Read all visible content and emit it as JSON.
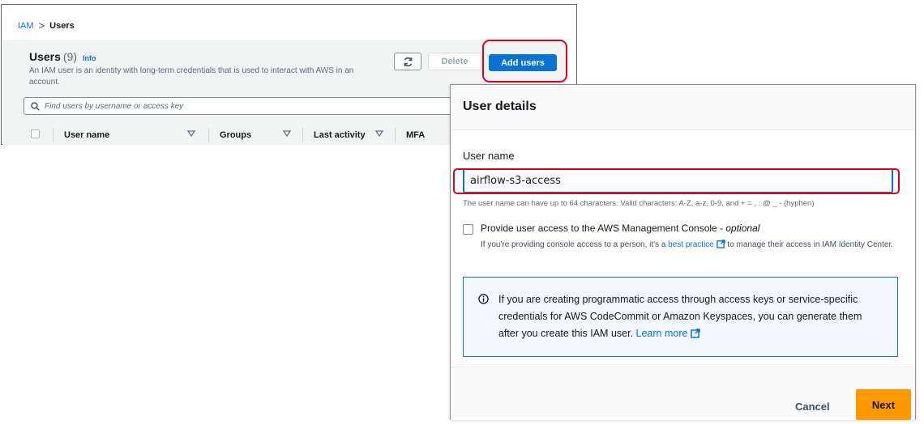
{
  "breadcrumb": {
    "root": "IAM",
    "separator": ">",
    "current": "Users"
  },
  "users": {
    "title": "Users",
    "count": "(9)",
    "info": "Info",
    "description": "An IAM user is an identity with long-term credentials that is used to interact with AWS in an account.",
    "delete_label": "Delete",
    "add_label": "Add users",
    "search_placeholder": "Find users by username or access key",
    "columns": [
      "User name",
      "Groups",
      "Last activity",
      "MFA"
    ]
  },
  "modal": {
    "title": "User details",
    "username_label": "User name",
    "username_value": "airflow-s3-access",
    "username_hint": "The user name can have up to 64 characters. Valid characters: A-Z, a-z, 0-9, and + = , . @ _ - (hyphen)",
    "console_label": "Provide user access to the AWS Management Console - ",
    "console_optional": "optional",
    "console_desc_pre": "If you're providing console access to a person, it's a ",
    "console_desc_link": "best practice",
    "console_desc_post": " to manage their access in IAM Identity Center.",
    "info_text": "If you are creating programmatic access through access keys or service-specific credentials for AWS CodeCommit or Amazon Keyspaces, you can generate them after you create this IAM user. ",
    "learn_more": "Learn more",
    "cancel_label": "Cancel",
    "next_label": "Next"
  },
  "icons": {
    "refresh": "refresh-icon",
    "search": "search-icon",
    "sort": "sort-caret-icon",
    "external": "external-link-icon",
    "info": "info-circle-icon"
  },
  "colors": {
    "primary": "#0972d3",
    "highlight": "#e4001b",
    "next": "#ff9900"
  }
}
